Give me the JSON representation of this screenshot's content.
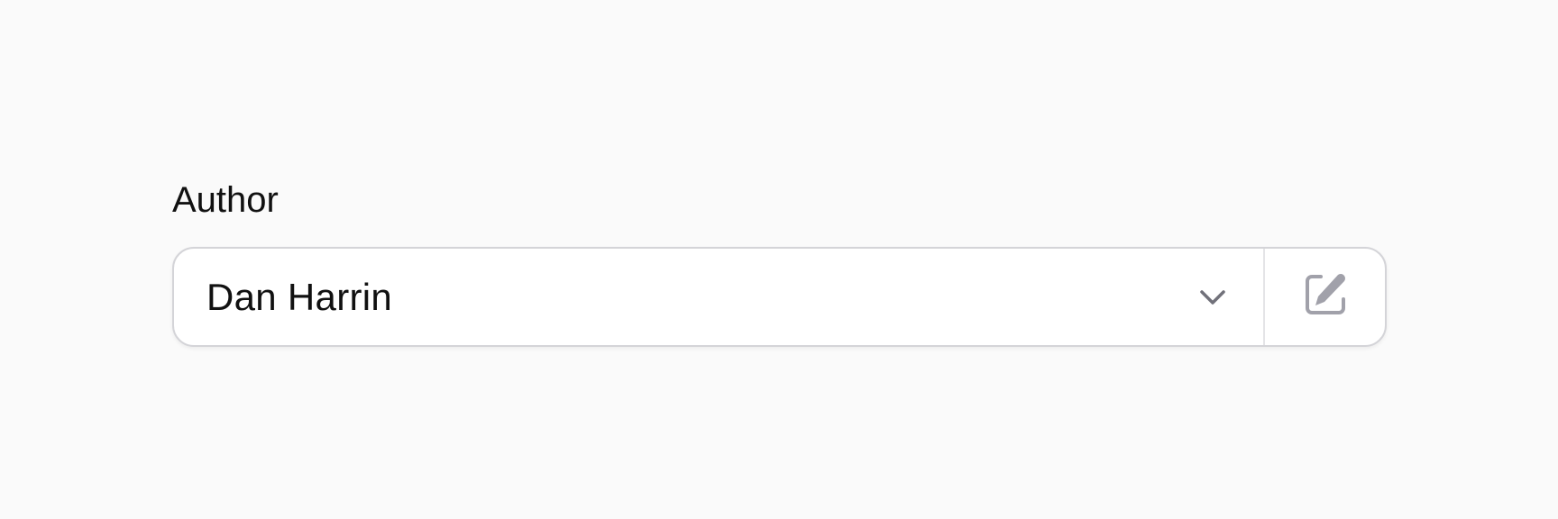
{
  "field": {
    "label": "Author",
    "selected_value": "Dan Harrin"
  },
  "icons": {
    "dropdown": "chevron-down-icon",
    "edit": "pencil-square-icon"
  },
  "colors": {
    "background": "#fafafa",
    "input_border": "#d4d4d8",
    "icon_gray": "#a1a1aa",
    "chevron_gray": "#71717a"
  }
}
